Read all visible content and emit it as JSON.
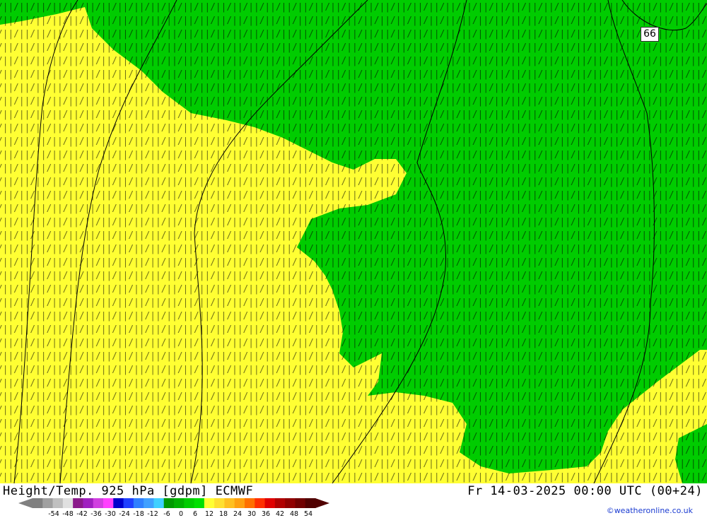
{
  "header": {
    "title_left": "Height/Temp. 925 hPa [gdpm] ECMWF",
    "title_right": "Fr 14-03-2025 00:00 UTC (00+24)"
  },
  "credit": "©weatheronline.co.uk",
  "map": {
    "contour_label": "66",
    "colors": {
      "warm": "#ffff33",
      "cool": "#00cc00",
      "lines": "#000000"
    }
  },
  "legend": {
    "ticks": [
      "-54",
      "-48",
      "-42",
      "-36",
      "-30",
      "-24",
      "-18",
      "-12",
      "-6",
      "0",
      "6",
      "12",
      "18",
      "24",
      "30",
      "36",
      "42",
      "48",
      "54"
    ],
    "colors": [
      "#808080",
      "#a0a0a0",
      "#c0c0c0",
      "#e0e0e0",
      "#8b1a8b",
      "#a020c0",
      "#d040e0",
      "#ff40ff",
      "#0000cc",
      "#2040ff",
      "#3080ff",
      "#40a0ff",
      "#40d0ff",
      "#009900",
      "#00b000",
      "#00cc00",
      "#00e000",
      "#ffff33",
      "#ffe030",
      "#ffc020",
      "#ffa010",
      "#ff7000",
      "#ff3000",
      "#e00000",
      "#b00000",
      "#900000",
      "#700000",
      "#500000"
    ]
  }
}
